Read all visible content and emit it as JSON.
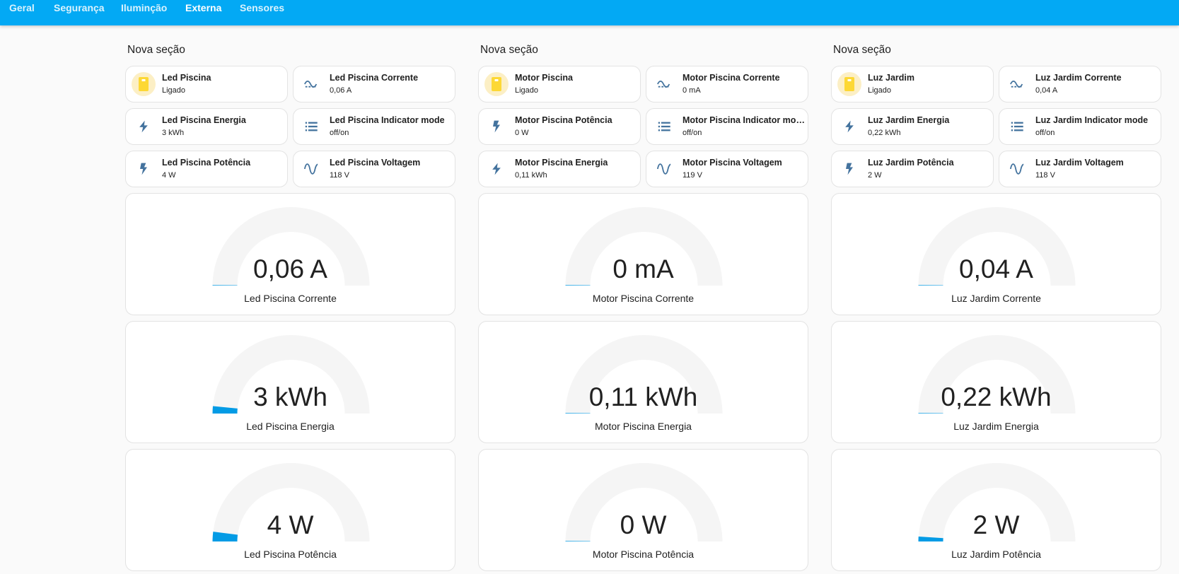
{
  "nav": {
    "tabs": [
      {
        "label": "Geral",
        "active": false
      },
      {
        "label": "Segurança",
        "active": false
      },
      {
        "label": "Iluminção",
        "active": false
      },
      {
        "label": "Externa",
        "active": true
      },
      {
        "label": "Sensores",
        "active": false
      }
    ]
  },
  "colors": {
    "header": "#03a9f4",
    "gauge_track": "#f5f5f5",
    "gauge_fill": "#039be5",
    "icon": "#44739e",
    "switch_on": "#fdd835",
    "switch_bg": "#fcefc5"
  },
  "sections": [
    {
      "title": "Nova seção",
      "tiles": [
        {
          "name": "Led Piscina",
          "state": "Ligado",
          "icon": "switch-icon"
        },
        {
          "name": "Led Piscina Corrente",
          "state": "0,06 A",
          "icon": "current-ac-icon"
        },
        {
          "name": "Led Piscina Energia",
          "state": "3 kWh",
          "icon": "lightning-icon"
        },
        {
          "name": "Led Piscina Indicator mode",
          "state": "off/on",
          "icon": "list-icon"
        },
        {
          "name": "Led Piscina Potência",
          "state": "4 W",
          "icon": "flash-icon"
        },
        {
          "name": "Led Piscina Voltagem",
          "state": "118 V",
          "icon": "sine-wave-icon"
        }
      ],
      "gauges": [
        {
          "value": "0,06 A",
          "name": "Led Piscina Corrente",
          "level": 0.0
        },
        {
          "value": "3 kWh",
          "name": "Led Piscina Energia",
          "level": 0.03
        },
        {
          "value": "4 W",
          "name": "Led Piscina Potência",
          "level": 0.04
        }
      ]
    },
    {
      "title": "Nova seção",
      "tiles": [
        {
          "name": "Motor Piscina",
          "state": "Ligado",
          "icon": "switch-icon"
        },
        {
          "name": "Motor Piscina Corrente",
          "state": "0 mA",
          "icon": "current-ac-icon"
        },
        {
          "name": "Motor Piscina Potência",
          "state": "0 W",
          "icon": "flash-icon"
        },
        {
          "name": "Motor Piscina Indicator mode",
          "state": "off/on",
          "icon": "list-icon"
        },
        {
          "name": "Motor Piscina Energia",
          "state": "0,11 kWh",
          "icon": "lightning-icon"
        },
        {
          "name": "Motor Piscina Voltagem",
          "state": "119 V",
          "icon": "sine-wave-icon"
        }
      ],
      "gauges": [
        {
          "value": "0 mA",
          "name": "Motor Piscina Corrente",
          "level": 0.0
        },
        {
          "value": "0,11 kWh",
          "name": "Motor Piscina Energia",
          "level": 0.0
        },
        {
          "value": "0 W",
          "name": "Motor Piscina Potência",
          "level": 0.0
        }
      ]
    },
    {
      "title": "Nova seção",
      "tiles": [
        {
          "name": "Luz Jardim",
          "state": "Ligado",
          "icon": "switch-icon"
        },
        {
          "name": "Luz Jardim Corrente",
          "state": "0,04 A",
          "icon": "current-ac-icon"
        },
        {
          "name": "Luz Jardim Energia",
          "state": "0,22 kWh",
          "icon": "lightning-icon"
        },
        {
          "name": "Luz Jardim Indicator mode",
          "state": "off/on",
          "icon": "list-icon"
        },
        {
          "name": "Luz Jardim Potência",
          "state": "2 W",
          "icon": "flash-icon"
        },
        {
          "name": "Luz Jardim Voltagem",
          "state": "118 V",
          "icon": "sine-wave-icon"
        }
      ],
      "gauges": [
        {
          "value": "0,04 A",
          "name": "Luz Jardim Corrente",
          "level": 0.0
        },
        {
          "value": "0,22 kWh",
          "name": "Luz Jardim Energia",
          "level": 0.0
        },
        {
          "value": "2 W",
          "name": "Luz Jardim Potência",
          "level": 0.02
        }
      ]
    }
  ]
}
